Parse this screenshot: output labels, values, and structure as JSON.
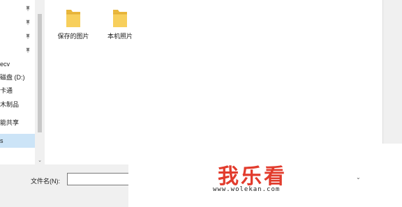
{
  "nav": {
    "pinned_count": 4,
    "items": [
      {
        "label": "ecv"
      },
      {
        "label": "磁盘 (D:)"
      },
      {
        "label": "卡通"
      },
      {
        "label": "木制品"
      },
      {
        "label": "能共享"
      },
      {
        "label": "s"
      }
    ]
  },
  "folders": [
    {
      "name": "保存的图片",
      "icon": "folder-icon"
    },
    {
      "name": "本机照片",
      "icon": "folder-icon"
    }
  ],
  "footer": {
    "filename_label": "文件名(N):",
    "filename_value": ""
  },
  "watermark": {
    "brand": "我乐看",
    "url": "www.wolekan.com"
  },
  "colors": {
    "folder": "#f5c74a",
    "selection": "#cce4f7",
    "watermark": "#e23b2c"
  }
}
